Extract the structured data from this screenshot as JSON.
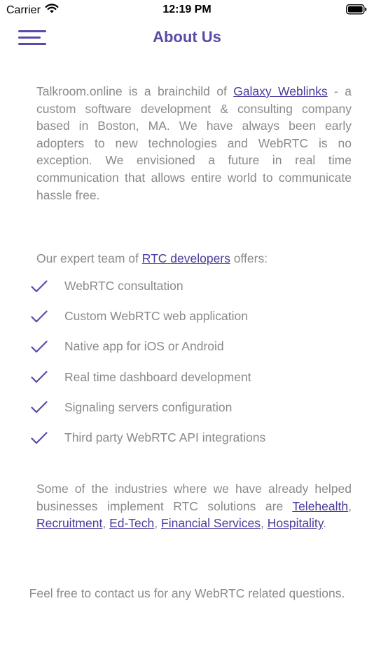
{
  "status_bar": {
    "carrier": "Carrier",
    "time": "12:19 PM",
    "wifi_icon": "wifi-icon",
    "battery_icon": "battery-icon"
  },
  "nav": {
    "title": "About Us",
    "menu_icon": "hamburger-menu-icon"
  },
  "intro": {
    "text_before": "Talkroom.online is a brainchild of ",
    "link": "Galaxy Weblinks",
    "text_after": " - a custom software development & consulting company based in Boston, MA. We have always been early adopters to new technologies and WebRTC is no exception. We envisioned a future in real time communication that allows entire world to communicate hassle free."
  },
  "team": {
    "text_before": "Our expert team of ",
    "link": "RTC developers",
    "text_after": " offers:"
  },
  "services": [
    "WebRTC consultation",
    "Custom WebRTC web application",
    "Native app for iOS or Android",
    "Real time dashboard development",
    "Signaling servers configuration",
    "Third party WebRTC API integrations"
  ],
  "industries": {
    "text_before": "Some of the industries where we have already helped businesses implement RTC solutions are ",
    "links": [
      "Telehealth",
      "Recruitment",
      "Ed-Tech",
      "Financial Services",
      "Hospitality"
    ],
    "separator": ", ",
    "text_after": "."
  },
  "contact": "Feel free to contact us for any WebRTC related questions.",
  "colors": {
    "accent": "#5a4aa8",
    "link": "#4b3c9c",
    "body_text": "#8a8a8a",
    "background": "#ffffff"
  }
}
